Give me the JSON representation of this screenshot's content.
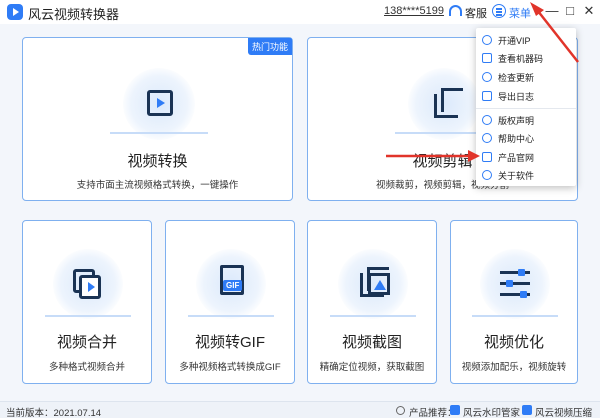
{
  "app": {
    "title": "风云视频转换器",
    "phone": "138****5199",
    "service_label": "客服",
    "menu_label": "菜单",
    "min_glyph": "—",
    "max_glyph": "□",
    "close_glyph": "✕"
  },
  "cards": [
    {
      "title": "视频转换",
      "desc": "支持市面主流视频格式转换，一键操作",
      "badge": "热门功能",
      "icon": "video-convert-icon"
    },
    {
      "title": "视频剪辑",
      "desc": "视频裁剪，视频剪辑，视频分割",
      "icon": "crop-icon"
    },
    {
      "title": "视频合并",
      "desc": "多种格式视频合并",
      "icon": "merge-icon"
    },
    {
      "title": "视频转GIF",
      "desc": "多种视频格式转换成GIF",
      "icon": "gif-file-icon",
      "icon_text": "GIF"
    },
    {
      "title": "视频截图",
      "desc": "精确定位视频，获取截图",
      "icon": "screenshot-icon"
    },
    {
      "title": "视频优化",
      "desc": "视频添加配乐，视频旋转",
      "icon": "sliders-icon"
    }
  ],
  "menu": {
    "items": [
      {
        "label": "开通VIP",
        "icon": "vip-icon"
      },
      {
        "label": "查看机器码",
        "icon": "machine-code-icon"
      },
      {
        "label": "检查更新",
        "icon": "update-icon"
      },
      {
        "label": "导出日志",
        "icon": "log-icon"
      },
      {
        "label": "版权声明",
        "icon": "copyright-icon"
      },
      {
        "label": "帮助中心",
        "icon": "help-icon"
      },
      {
        "label": "产品官网",
        "icon": "website-icon"
      },
      {
        "label": "关于软件",
        "icon": "about-icon"
      }
    ]
  },
  "status": {
    "version": "当前版本：2021.07.14",
    "recommend_label": "产品推荐：",
    "rec1": "风云水印管家",
    "rec2": "风云视频压缩"
  },
  "colors": {
    "accent": "#2f7cf6",
    "icon_dark": "#1a3354",
    "annotation": "#e1342a"
  }
}
